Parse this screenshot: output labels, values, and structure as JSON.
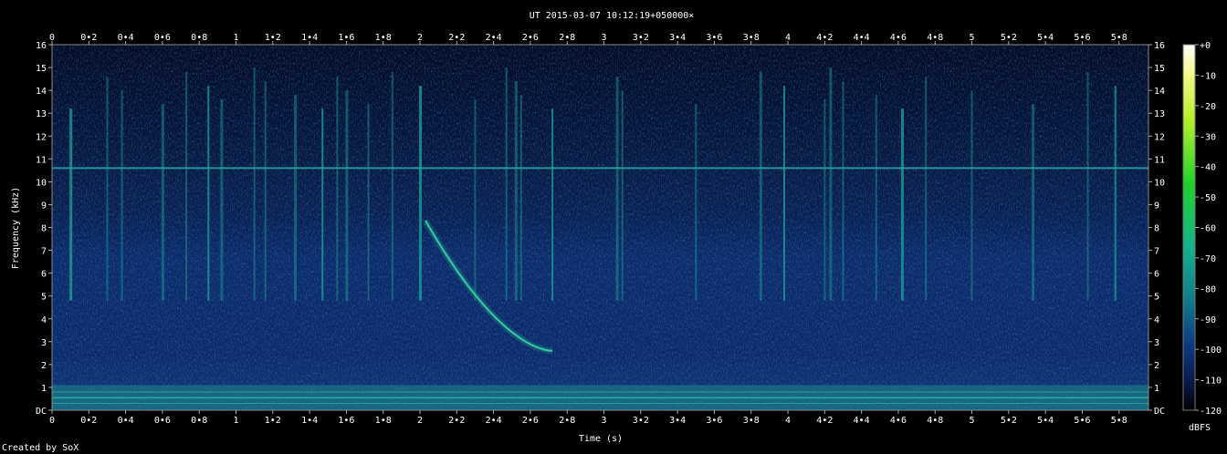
{
  "chart_data": {
    "type": "heatmap",
    "title": "UT 2015-03-07 10:12:19+050000×",
    "xlabel": "Time (s)",
    "ylabel": "Frequency (kHz)",
    "xlim": [
      0,
      5.96
    ],
    "ylim": [
      0,
      16
    ],
    "x_ticks": [
      "0",
      "0•2",
      "0•4",
      "0•6",
      "0•8",
      "1",
      "1•2",
      "1•4",
      "1•6",
      "1•8",
      "2",
      "2•2",
      "2•4",
      "2•6",
      "2•8",
      "3",
      "3•2",
      "3•4",
      "3•6",
      "3•8",
      "4",
      "4•2",
      "4•4",
      "4•6",
      "4•8",
      "5",
      "5•2",
      "5•4",
      "5•6",
      "5•8"
    ],
    "x_tick_values": [
      0,
      0.2,
      0.4,
      0.6,
      0.8,
      1.0,
      1.2,
      1.4,
      1.6,
      1.8,
      2.0,
      2.2,
      2.4,
      2.6,
      2.8,
      3.0,
      3.2,
      3.4,
      3.6,
      3.8,
      4.0,
      4.2,
      4.4,
      4.6,
      4.8,
      5.0,
      5.2,
      5.4,
      5.6,
      5.8
    ],
    "y_ticks": [
      "DC",
      "1",
      "2",
      "3",
      "4",
      "5",
      "6",
      "7",
      "8",
      "9",
      "10",
      "11",
      "12",
      "13",
      "14",
      "15",
      "16"
    ],
    "y_tick_values": [
      0,
      1,
      2,
      3,
      4,
      5,
      6,
      7,
      8,
      9,
      10,
      11,
      12,
      13,
      14,
      15,
      16
    ],
    "colorbar": {
      "label": "dBFS",
      "ticks": [
        "+0",
        "-10",
        "-20",
        "-30",
        "-40",
        "-50",
        "-60",
        "-70",
        "-80",
        "-90",
        "-100",
        "-110",
        "-120"
      ],
      "tick_values": [
        0,
        -10,
        -20,
        -30,
        -40,
        -50,
        -60,
        -70,
        -80,
        -90,
        -100,
        -110,
        -120
      ],
      "range": [
        -120,
        0
      ]
    },
    "features": {
      "carrier_line_khz": 10.6,
      "low_band_khz": [
        0,
        1.1
      ],
      "whistler": {
        "start_time_s": 2.03,
        "start_freq_khz": 8.3,
        "end_time_s": 2.72,
        "end_freq_khz": 2.6
      },
      "sferics_time_s": [
        0.1,
        0.3,
        0.38,
        0.6,
        0.73,
        0.85,
        0.92,
        1.1,
        1.16,
        1.32,
        1.47,
        1.55,
        1.6,
        1.72,
        1.85,
        2.0,
        2.3,
        2.47,
        2.52,
        2.55,
        2.72,
        3.07,
        3.1,
        3.5,
        3.85,
        3.98,
        4.2,
        4.23,
        4.3,
        4.48,
        4.62,
        4.75,
        5.0,
        5.33,
        5.63,
        5.78
      ]
    }
  },
  "footer": "Created by SoX"
}
